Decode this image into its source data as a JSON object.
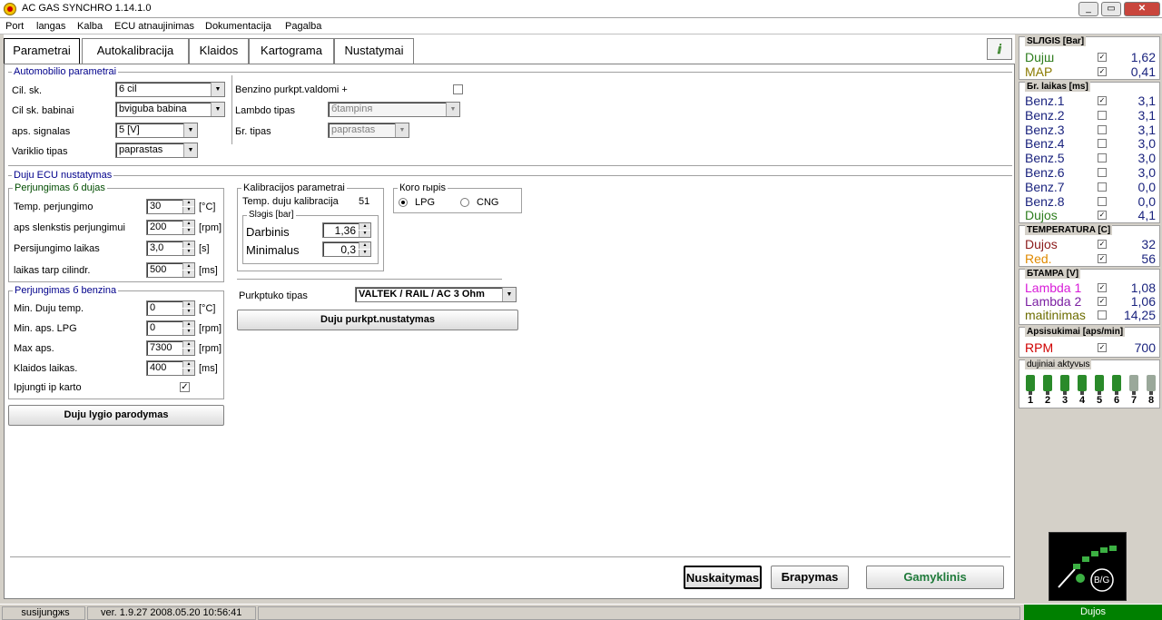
{
  "window": {
    "title": "AC GAS SYNCHRO   1.14.1.0"
  },
  "menu": [
    "Port",
    "langas",
    "Kalba",
    "ECU atnaujinimas",
    "Dokumentacija",
    "Pagalba"
  ],
  "tabs": [
    "Parametrai",
    "Autokalibracija",
    "Klaidos",
    "Kartograma",
    "Nustatymai"
  ],
  "vehicle": {
    "title": "Automobilio parametrai",
    "cyl_label": "Cil. sk.",
    "cyl_value": "6 cil",
    "coil_label": "Cil sk. babinai",
    "coil_value": "bviguba babina",
    "rpm_label": "aps. signalas",
    "rpm_value": "5 [V]",
    "engine_label": "Variklio tipas",
    "engine_value": "paprastas",
    "petrol_label": "Benzino purkpt.valdomi +",
    "lambda_label": "Lambdo tipas",
    "lambda_value": "бtampinя",
    "br_label": "Бr. tipas",
    "br_value": "paprastas"
  },
  "ecu": {
    "title": "Duju ECU nustatymas",
    "switch_gas": {
      "title": "Perjungimas б dujas",
      "temp_label": "Temp. perjungimo",
      "temp_value": "30",
      "temp_unit": "[°C]",
      "rpm_label": "aps slenkstis perjungimui",
      "rpm_value": "200",
      "rpm_unit": "[rpm]",
      "time_label": "Persijungimo laikas",
      "time_value": "3,0",
      "time_unit": "[s]",
      "gap_label": "laikas tarp cilindr.",
      "gap_value": "500",
      "gap_unit": "[ms]"
    },
    "switch_petrol": {
      "title": "Perjungimas б benzina",
      "mintemp_label": "Min. Duju temp.",
      "mintemp_value": "0",
      "mintemp_unit": "[°C]",
      "minrpm_label": "Min. aps. LPG",
      "minrpm_value": "0",
      "minrpm_unit": "[rpm]",
      "maxrpm_label": "Max aps.",
      "maxrpm_value": "7300",
      "maxrpm_unit": "[rpm]",
      "err_label": "Klaidos laikas.",
      "err_value": "400",
      "err_unit": "[ms]",
      "once_label": "Ipjungti ip karto"
    },
    "level_button": "Duju lygio parodymas",
    "calib": {
      "title": "Kalibracijos parametrai",
      "temp_label": "Temp. duju kalibracija",
      "temp_value": "51",
      "press_title": "Slэgis [bar]",
      "work_label": "Darbinis",
      "work_value": "1,36",
      "min_label": "Minimalus",
      "min_value": "0,3"
    },
    "fuel": {
      "title": "Коro rырis",
      "lpg": "LPG",
      "cng": "CNG"
    },
    "injector_label": "Purkptuko tipas",
    "injector_value": "VALTEK / RAIL / AC 3 Ohm",
    "injector_button": "Duju purkpt.nustatymas"
  },
  "buttons": {
    "read": "Nuskaitymas",
    "write": "Бrapymas",
    "factory": "Gamyklinis"
  },
  "status": {
    "conn": "susijungжs",
    "ver": "ver. 1.9.27   2008.05.20  10:56:41",
    "gas": "Dujos"
  },
  "side": {
    "pressure": {
      "title": "SLЛGIS [Bar]",
      "rows": [
        {
          "name": "Dujш",
          "value": "1,62",
          "color": "#2e7d1e"
        },
        {
          "name": "MAP",
          "value": "0,41",
          "color": "#8a7a00"
        }
      ]
    },
    "inj": {
      "title": "Бr. laikas  [ms]",
      "rows": [
        {
          "name": "Benz.1",
          "value": "3,1",
          "color": "#1a237e"
        },
        {
          "name": "Benz.2",
          "value": "3,1",
          "color": "#1a237e"
        },
        {
          "name": "Benz.3",
          "value": "3,1",
          "color": "#1a237e"
        },
        {
          "name": "Benz.4",
          "value": "3,0",
          "color": "#1a237e"
        },
        {
          "name": "Benz.5",
          "value": "3,0",
          "color": "#1a237e"
        },
        {
          "name": "Benz.6",
          "value": "3,0",
          "color": "#1a237e"
        },
        {
          "name": "Benz.7",
          "value": "0,0",
          "color": "#1a237e"
        },
        {
          "name": "Benz.8",
          "value": "0,0",
          "color": "#1a237e"
        },
        {
          "name": "Dujos",
          "value": "4,1",
          "color": "#2e7d1e"
        }
      ]
    },
    "temp": {
      "title": "TEMPERATURA  [C]",
      "rows": [
        {
          "name": "Dujos",
          "value": "32",
          "color": "#8b1a1a"
        },
        {
          "name": "Red.",
          "value": "56",
          "color": "#e08a00"
        }
      ]
    },
    "volt": {
      "title": "БТАМРА [V]",
      "rows": [
        {
          "name": "Lambda 1",
          "value": "1,08",
          "color": "#d81bd8"
        },
        {
          "name": "Lambda 2",
          "value": "1,06",
          "color": "#7b1fa2"
        },
        {
          "name": "maitinimas",
          "value": "14,25",
          "color": "#6d6d00"
        }
      ]
    },
    "rpm": {
      "title": "Apsisukimai [aps/min]",
      "rows": [
        {
          "name": "RPM",
          "value": "700",
          "color": "#d00000"
        }
      ]
    },
    "injectors": {
      "title": "dujiniai aktyvыs",
      "nums": [
        "1",
        "2",
        "3",
        "4",
        "5",
        "6",
        "7",
        "8"
      ]
    },
    "logo_text": "B/G"
  }
}
